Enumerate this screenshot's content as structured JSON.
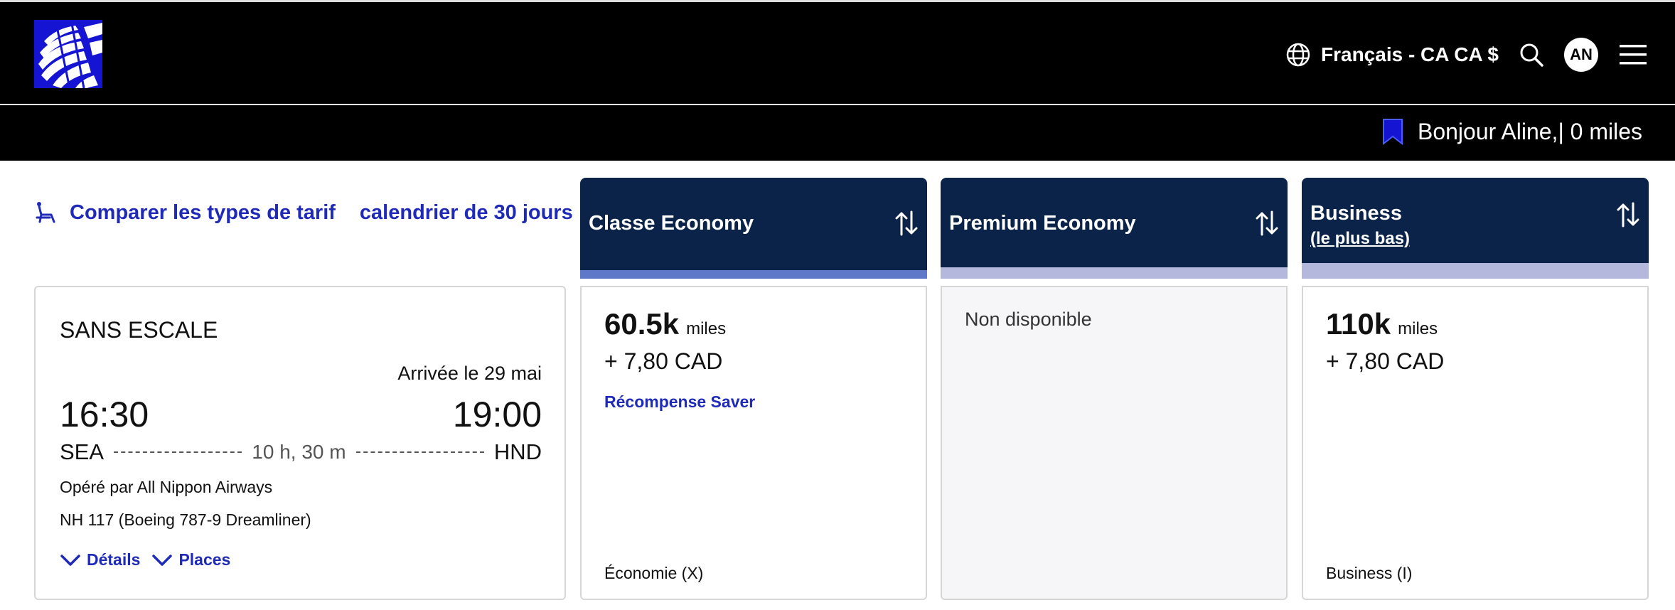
{
  "header": {
    "logo_icon": "united-globe-logo",
    "language": "Français - CA CA $",
    "avatar_initials": "AN",
    "greeting": "Bonjour Aline,| 0 miles"
  },
  "toolbar": {
    "compare_label": "Comparer les types de tarif",
    "calendar_label": "calendrier de 30 jours"
  },
  "columns": [
    {
      "title": "Classe Economy",
      "subtitle": ""
    },
    {
      "title": "Premium Economy",
      "subtitle": ""
    },
    {
      "title": "Business",
      "subtitle": "(le plus bas)"
    }
  ],
  "flight": {
    "stops": "SANS ESCALE",
    "arrival_note": "Arrivée le 29 mai",
    "departure_time": "16:30",
    "arrival_time": "19:00",
    "origin": "SEA",
    "destination": "HND",
    "duration": "10 h, 30 m",
    "operated_by": "Opéré par All Nippon Airways",
    "aircraft": "NH 117 (Boeing 787-9 Dreamliner)",
    "details_label": "Détails",
    "seats_label": "Places"
  },
  "fares": {
    "economy": {
      "miles": "60.5k",
      "unit": "miles",
      "taxes": "+ 7,80 CAD",
      "award": "Récompense Saver",
      "fare_class": "Économie (X)"
    },
    "premium": {
      "status": "Non disponible"
    },
    "business": {
      "miles": "110k",
      "unit": "miles",
      "taxes": "+ 7,80 CAD",
      "fare_class": "Business (I)"
    }
  },
  "colors": {
    "header_bg": "#000000",
    "column_header_bg": "#0b2349",
    "link_blue": "#1f2ab8",
    "band_lavender": "#b4b8dc",
    "logo_blue": "#1414d2"
  }
}
